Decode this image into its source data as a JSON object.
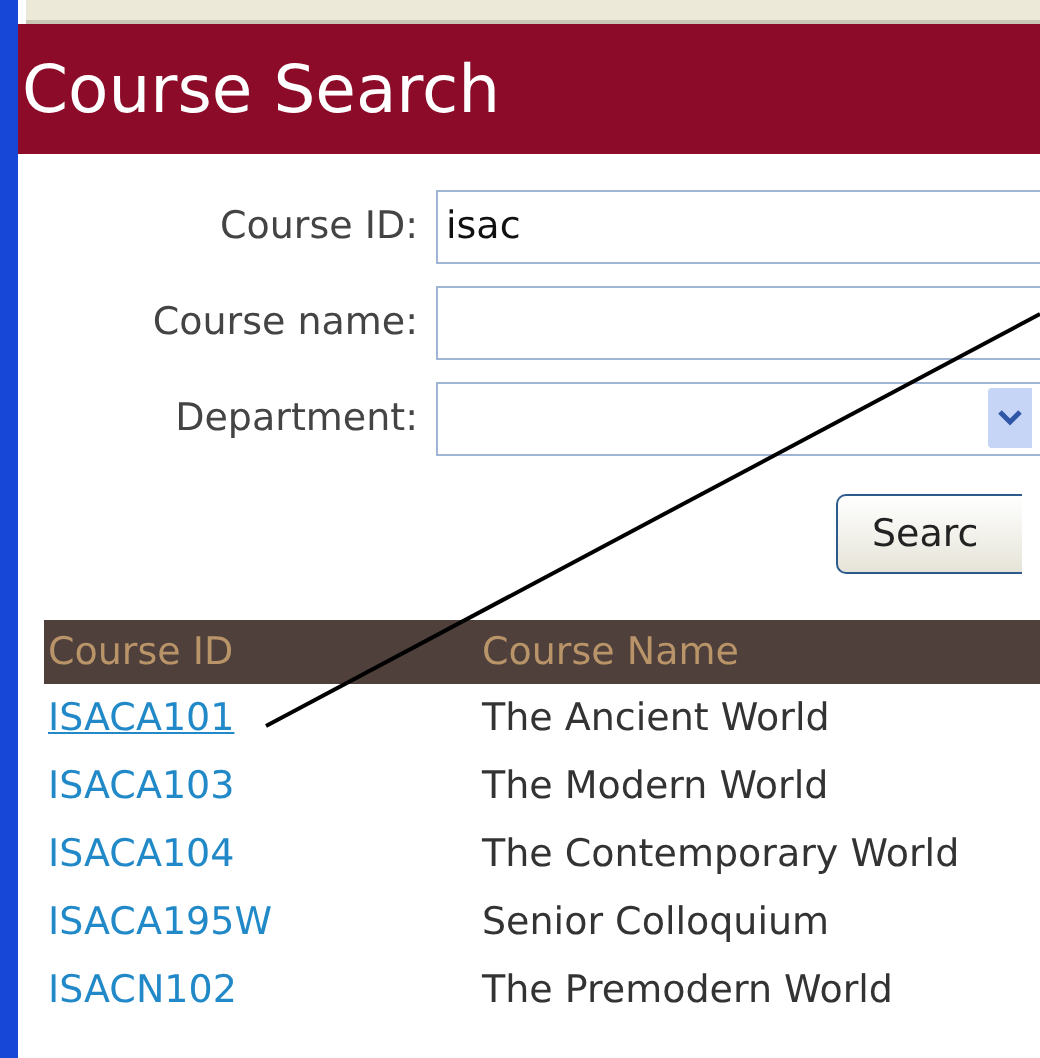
{
  "title": "Course Search",
  "form": {
    "fields": [
      {
        "kind": "text",
        "label": "Course ID:",
        "value": "isac"
      },
      {
        "kind": "text",
        "label": "Course name:"
      },
      {
        "kind": "select",
        "label": "Department:"
      }
    ],
    "button": "Searc"
  },
  "table": {
    "columns": [
      "Course ID",
      "Course Name"
    ],
    "rows": [
      {
        "id": "ISACA101",
        "name": "The Ancient World",
        "hovered": true
      },
      {
        "id": "ISACA103",
        "name": "The Modern World",
        "hovered": false
      },
      {
        "id": "ISACA104",
        "name": "The Contemporary World",
        "hovered": false
      },
      {
        "id": "ISACA195W",
        "name": "Senior Colloquium",
        "hovered": false
      },
      {
        "id": "ISACN102",
        "name": "The Premodern World",
        "hovered": false
      }
    ]
  }
}
